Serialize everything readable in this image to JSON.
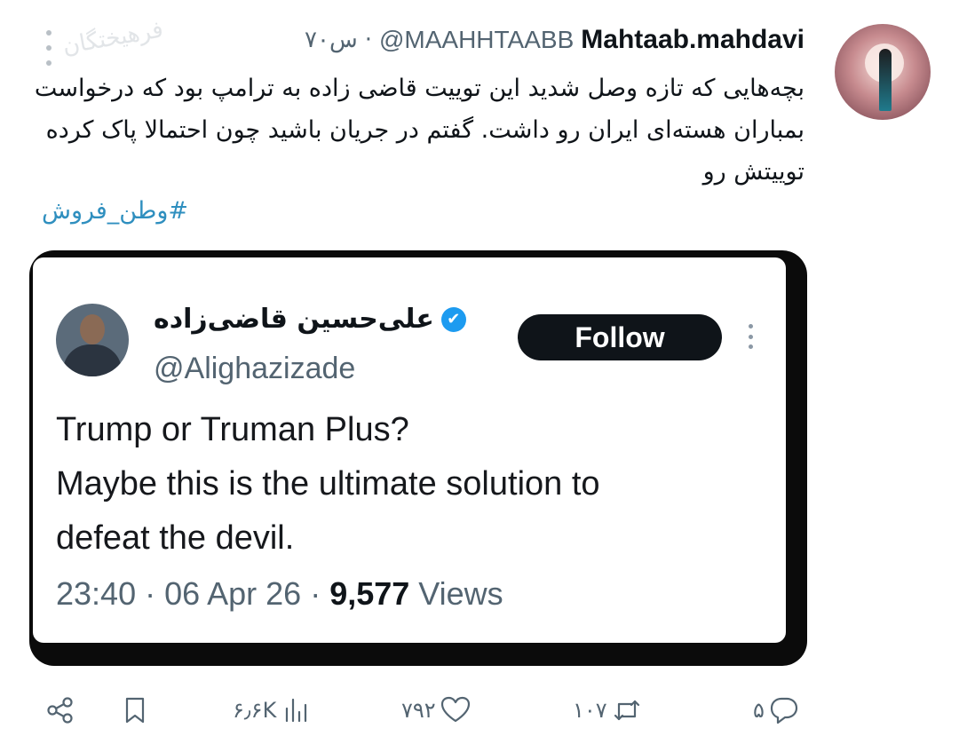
{
  "tweet": {
    "display_name": "Mahtaab.mahdavi",
    "handle": "@MAAHHTAABB",
    "separator": "·",
    "time": "۷۰س",
    "text": "بچه‌هایی که تازه وصل شدید این توییت قاضی زاده به ترامپ بود که درخواست بمباران هسته‌ای ایران رو داشت. گفتم در جریان باشید چون احتمالا پاک کرده توییتش رو",
    "hashtag": "#وطن_فروش",
    "watermark": "فرهیختگان"
  },
  "embedded": {
    "name": "علی‌حسین قاضی‌زاده",
    "verified_icon": "✔",
    "handle": "@Alighazizade",
    "follow_label": "Follow",
    "line1": "Trump or Truman Plus?",
    "line2": "Maybe this is the ultimate solution to",
    "line3": "defeat the devil.",
    "timestamp": "23:40 · 06 Apr 26 · ",
    "views_count": "9,577",
    "views_label": " Views"
  },
  "actions": {
    "views": "۶٫۶K",
    "likes": "۷۹۲",
    "retweets": "۱۰۷",
    "replies": "۵"
  }
}
